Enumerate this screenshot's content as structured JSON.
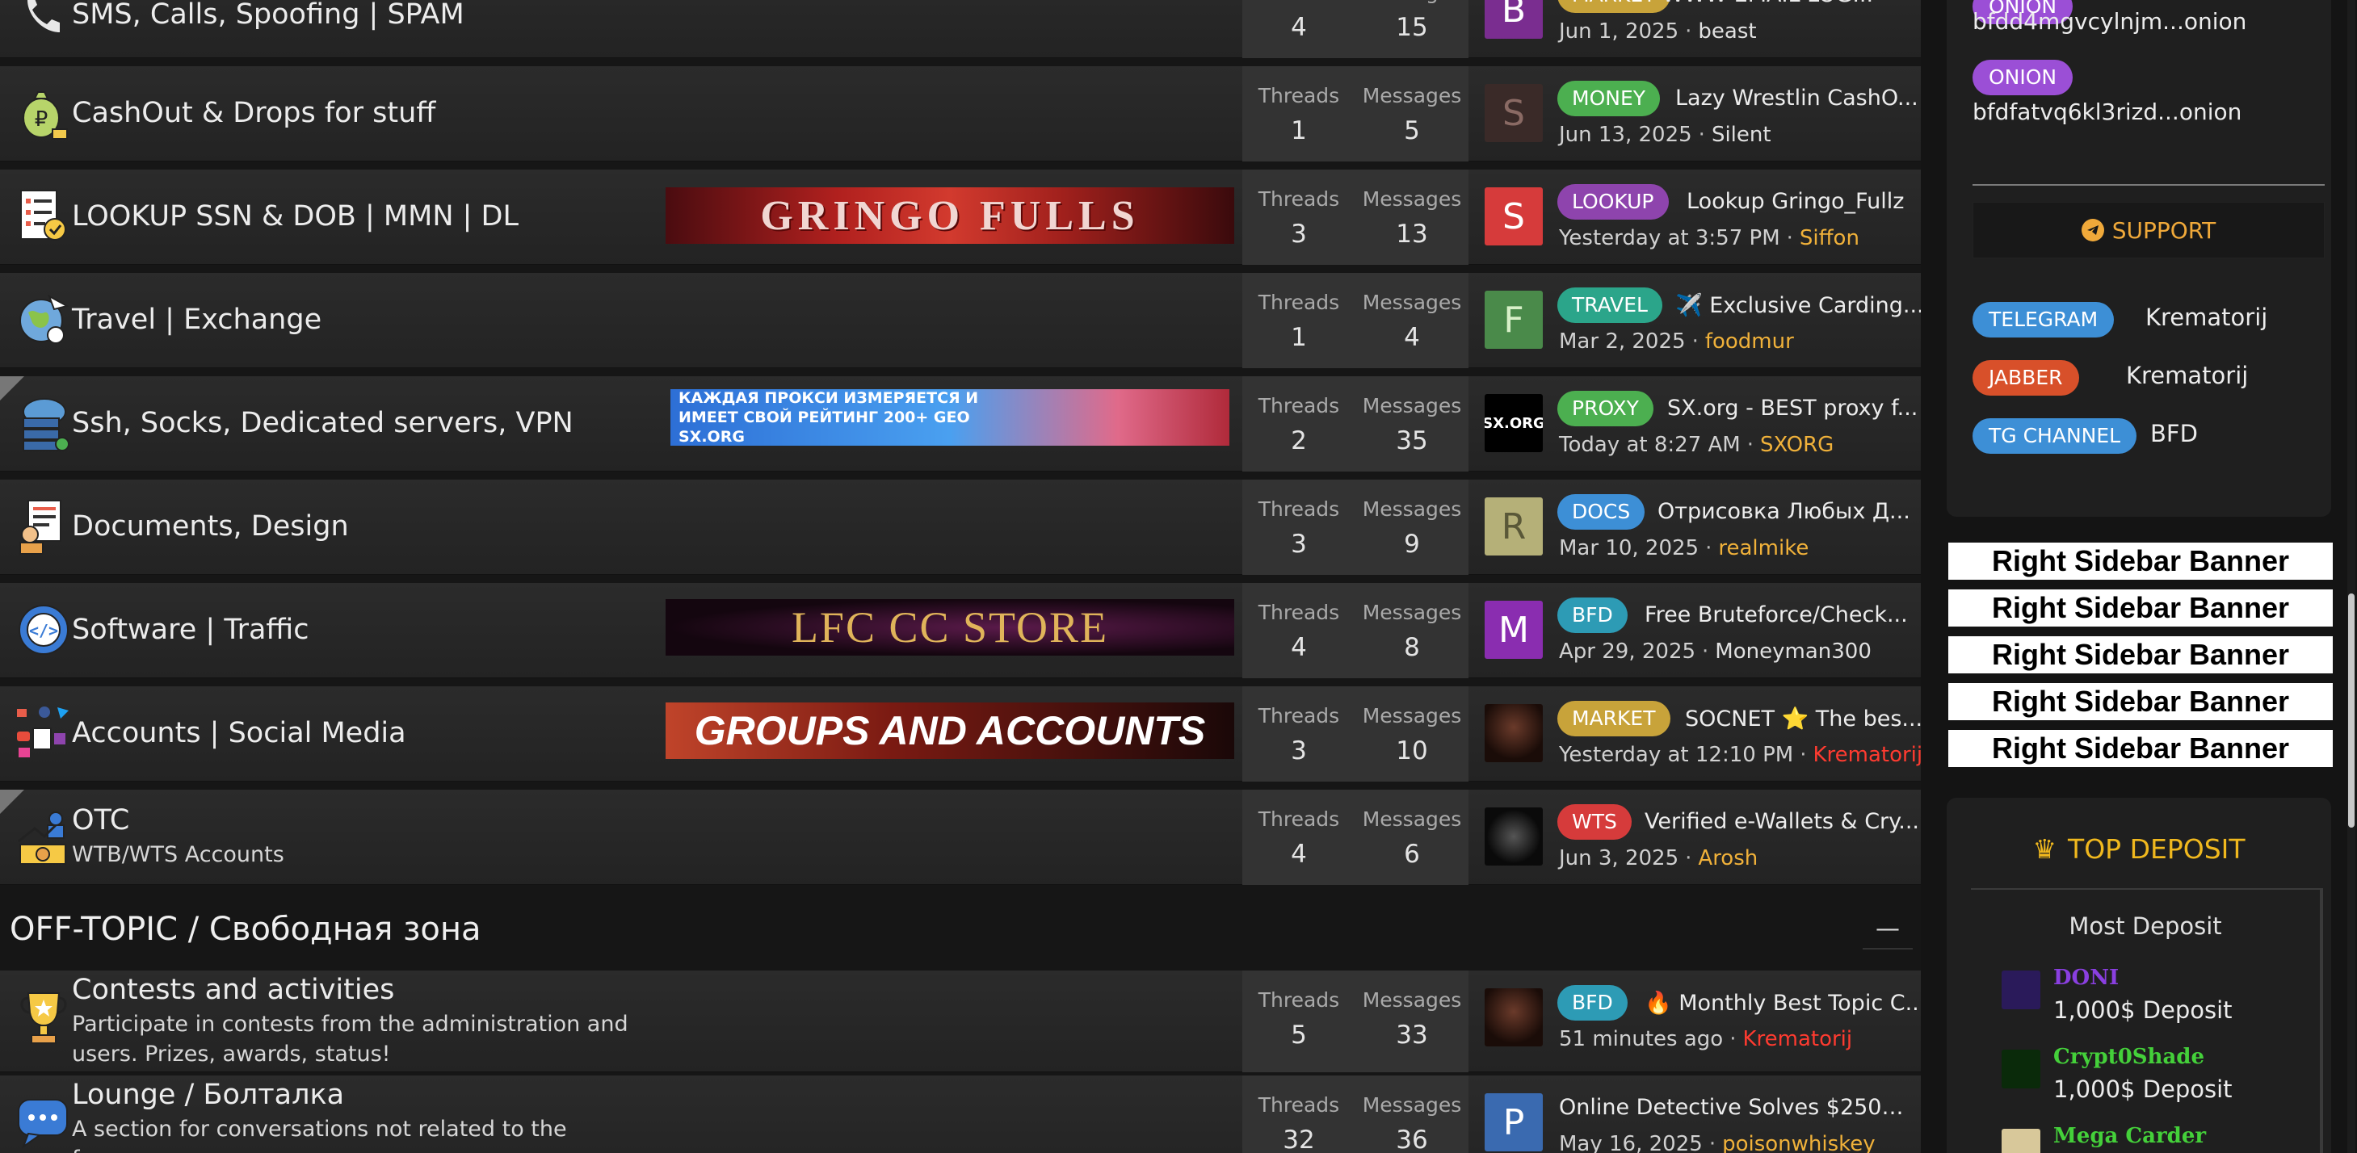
{
  "rows": [
    {
      "title": "SMS, Calls, Spoofing | SPAM",
      "threads": "4",
      "messages": "15",
      "tag": "MARKET",
      "tag_color": "#c8a33a",
      "thread_title": "WWW EMAIL LOG...",
      "date": "Jun 1, 2025",
      "user": "beast",
      "avatar_letter": "B",
      "avatar_color": "#7a2d90",
      "icon": "phone-icon",
      "banner": ""
    },
    {
      "title": "CashOut & Drops for stuff",
      "threads": "1",
      "messages": "5",
      "tag": "MONEY",
      "tag_color": "#4caf50",
      "thread_title": "Lazy Wrestlin CashO...",
      "date": "Jun 13, 2025",
      "user": "Silent",
      "avatar_letter": "S",
      "avatar_color": "#3a2a28",
      "icon": "money-bag-icon",
      "banner": ""
    },
    {
      "title": "LOOKUP SSN & DOB | MMN | DL",
      "threads": "3",
      "messages": "13",
      "tag": "LOOKUP",
      "tag_color": "#8e44ad",
      "thread_title": "Lookup Gringo_Fullz",
      "date": "Yesterday at 3:57 PM",
      "user": "Siffon",
      "avatar_letter": "S",
      "avatar_color": "#d63b3b",
      "icon": "document-check-icon",
      "banner": "GRINGO FULLS"
    },
    {
      "title": "Travel | Exchange",
      "threads": "1",
      "messages": "4",
      "tag": "TRAVEL",
      "tag_color": "#2ba58a",
      "thread_title": "✈️ Exclusive Carding...",
      "date": "Mar 2, 2025",
      "user": "foodmur",
      "avatar_letter": "F",
      "avatar_color": "#4a8a4a",
      "icon": "globe-icon",
      "banner": ""
    },
    {
      "title": "Ssh, Socks, Dedicated servers, VPN",
      "threads": "2",
      "messages": "35",
      "tag": "PROXY",
      "tag_color": "#4caf50",
      "thread_title": "SX.org - BEST proxy f...",
      "date": "Today at 8:27 AM",
      "user": "SXORG",
      "avatar_letter": "SX.ORG",
      "avatar_color": "#000000",
      "icon": "cloud-server-icon",
      "banner": "КАЖДАЯ ПРОКСИ ИЗМЕРЯЕТСЯ И ИМЕЕТ СВОЙ РЕЙТИНГ 200+ GEO SX.ORG"
    },
    {
      "title": "Documents, Design",
      "threads": "3",
      "messages": "9",
      "tag": "DOCS",
      "tag_color": "#3d8fd6",
      "thread_title": "Отрисовка Любых Д...",
      "date": "Mar 10, 2025",
      "user": "realmike",
      "avatar_letter": "R",
      "avatar_color": "#b5b078",
      "icon": "documents-icon",
      "banner": ""
    },
    {
      "title": "Software | Traffic",
      "threads": "4",
      "messages": "8",
      "tag": "BFD",
      "tag_color": "#2d9bb5",
      "thread_title": "Free Bruteforce/Check...",
      "date": "Apr 29, 2025",
      "user": "Moneyman300",
      "avatar_letter": "M",
      "avatar_color": "#8a2db0",
      "icon": "code-gear-icon",
      "banner": "LFC CC STORE"
    },
    {
      "title": "Accounts | Social Media",
      "threads": "3",
      "messages": "10",
      "tag": "MARKET",
      "tag_color": "#c8a33a",
      "thread_title": "SOCNET ⭐ The bes...",
      "date": "Yesterday at 12:10 PM",
      "user": "Krematorij",
      "avatar_letter": "",
      "avatar_color": "#2a1a16",
      "icon": "social-media-icon",
      "banner": "GROUPS AND ACCOUNTS"
    },
    {
      "title": "OTC",
      "subtitle": "WTB/WTS Accounts",
      "threads": "4",
      "messages": "6",
      "tag": "WTS",
      "tag_color": "#d63b3b",
      "thread_title": "Verified e-Wallets & Cry...",
      "date": "Jun 3, 2025",
      "user": "Arosh",
      "avatar_letter": "",
      "avatar_color": "#111111",
      "icon": "otc-exchange-icon",
      "banner": ""
    }
  ],
  "category": {
    "title": "OFF-TOPIC / Свободная зона",
    "collapse": "—"
  },
  "offtopic": [
    {
      "title": "Contests and activities",
      "desc": "Participate in contests from the administration and users. Prizes, awards, status!",
      "threads": "5",
      "messages": "33",
      "tag": "BFD",
      "tag_color": "#2d9bb5",
      "thread_title": "🔥 Monthly Best Topic C...",
      "date": "51 minutes ago",
      "user": "Krematorij",
      "icon": "trophy-icon"
    },
    {
      "title": "Lounge / Болталка",
      "desc": "A section for conversations not related to the forum",
      "threads": "32",
      "messages": "36",
      "tag": "",
      "thread_title": "Online Detective Solves $250 M...",
      "date": "May 16, 2025",
      "user": "poisonwhiskey",
      "avatar_letter": "P",
      "avatar_color": "#3a6ab0",
      "icon": "chat-bubble-icon"
    }
  ],
  "labels": {
    "threads": "Threads",
    "messages": "Messages"
  },
  "sidebar": {
    "onion_tag": "ONION",
    "onion_addr1": "bfdd4mgvcylnjm...onion",
    "onion_addr2": "bfdfatvq6kl3rizd...onion",
    "support": "SUPPORT",
    "contacts": [
      {
        "tag": "TELEGRAM",
        "color": "#3d8fd6",
        "value": "Krematorij"
      },
      {
        "tag": "JABBER",
        "color": "#d8502a",
        "value": "Krematorij"
      },
      {
        "tag": "TG CHANNEL",
        "color": "#3d8fd6",
        "value": "BFD"
      }
    ],
    "banners": [
      "Right Sidebar Banner",
      "Right Sidebar Banner",
      "Right Sidebar Banner",
      "Right Sidebar Banner",
      "Right Sidebar Banner"
    ],
    "top_deposit": "TOP DEPOSIT",
    "most_deposit": "Most Deposit",
    "depositors": [
      {
        "name": "DONI",
        "amount": "1,000$ Deposit",
        "color": "#8a3fe0"
      },
      {
        "name": "Crypt0Shade",
        "amount": "1,000$ Deposit",
        "color": "#44d03a"
      },
      {
        "name": "Mega Carder",
        "amount": "",
        "color": "#44d03a"
      }
    ]
  }
}
